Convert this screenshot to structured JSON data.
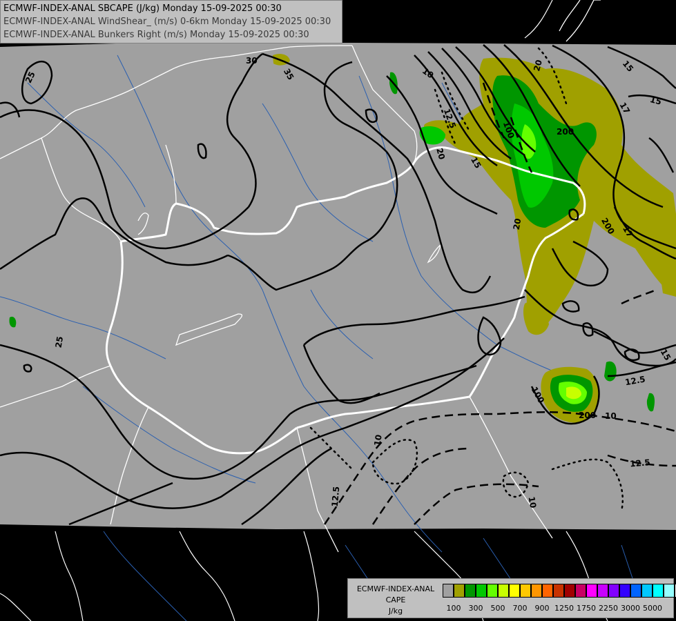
{
  "header": {
    "line1": "ECMWF-INDEX-ANAL SBCAPE (J/kg) Monday 15-09-2025 00:30",
    "line2": "ECMWF-INDEX-ANAL WindShear_ (m/s) 0-6km Monday 15-09-2025 00:30",
    "line3": "ECMWF-INDEX-ANAL Bunkers Right (m/s) Monday 15-09-2025 00:30"
  },
  "legend": {
    "title1": "ECMWF-INDEX-ANAL",
    "title2": "CAPE",
    "title3": "J/kg",
    "colors": [
      "#a0a0a0",
      "#a0a000",
      "#009600",
      "#00c800",
      "#64ff00",
      "#c8ff00",
      "#ffff00",
      "#ffc800",
      "#ff9600",
      "#ff6400",
      "#c83200",
      "#a00000",
      "#c80064",
      "#ff00ff",
      "#c800ff",
      "#8200ff",
      "#3200ff",
      "#0064ff",
      "#00c8ff",
      "#00ffff",
      "#96ffff",
      "#ffffff"
    ],
    "ticks": [
      "100",
      "300",
      "500",
      "700",
      "900",
      "1250",
      "1750",
      "2250",
      "3000",
      "5000"
    ]
  },
  "contour_labels": {
    "l25": "25",
    "l30": "30",
    "l35": "35",
    "l20": "20",
    "l15": "15",
    "l125": "12.5",
    "l10": "10",
    "l100": "100",
    "l200": "200",
    "l17": "17"
  }
}
